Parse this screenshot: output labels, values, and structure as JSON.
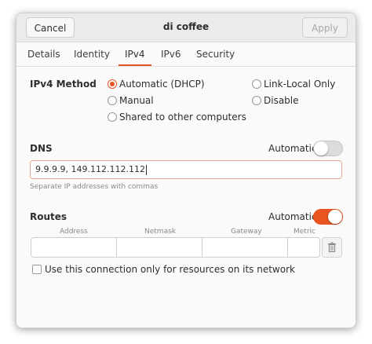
{
  "window": {
    "title": "di coffee",
    "cancel_label": "Cancel",
    "apply_label": "Apply"
  },
  "tabs": [
    {
      "label": "Details"
    },
    {
      "label": "Identity"
    },
    {
      "label": "IPv4"
    },
    {
      "label": "IPv6"
    },
    {
      "label": "Security"
    }
  ],
  "active_tab": "IPv4",
  "ipv4": {
    "method_label": "IPv4 Method",
    "options": [
      {
        "label": "Automatic (DHCP)",
        "checked": true
      },
      {
        "label": "Link-Local Only",
        "checked": false
      },
      {
        "label": "Manual",
        "checked": false
      },
      {
        "label": "Disable",
        "checked": false
      },
      {
        "label": "Shared to other computers",
        "checked": false
      }
    ]
  },
  "dns": {
    "label": "DNS",
    "automatic_label": "Automatic",
    "automatic_on": false,
    "value": "9.9.9.9, 149.112.112.112",
    "hint": "Separate IP addresses with commas"
  },
  "routes": {
    "label": "Routes",
    "automatic_label": "Automatic",
    "automatic_on": true,
    "columns": [
      "Address",
      "Netmask",
      "Gateway",
      "Metric"
    ]
  },
  "only_resources_label": "Use this connection only for resources on its network",
  "colors": {
    "accent": "#e95420"
  }
}
